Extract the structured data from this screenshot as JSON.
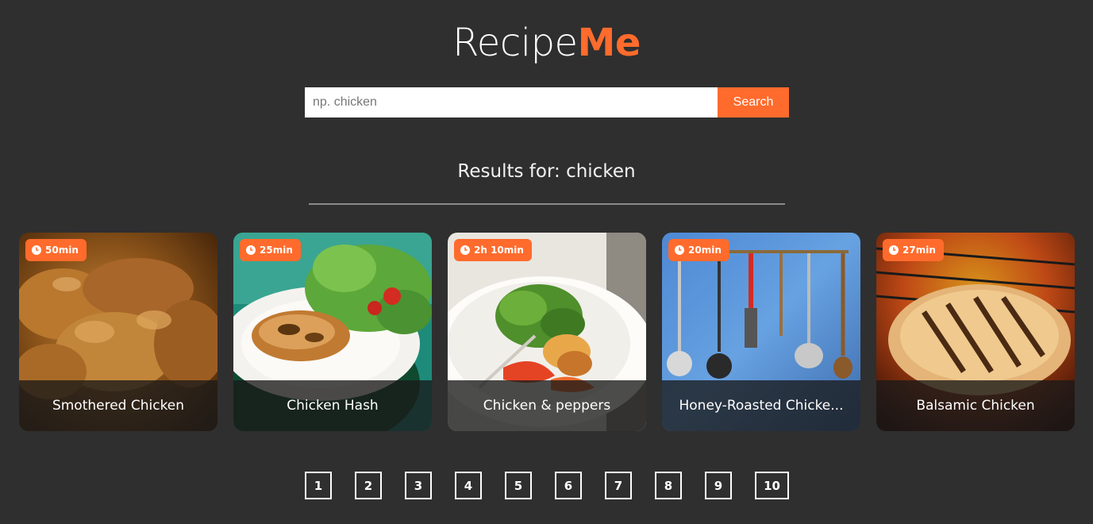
{
  "logo": {
    "part1": "Recipe",
    "part2": "Me"
  },
  "search": {
    "placeholder": "np. chicken",
    "value": "",
    "button_label": "Search"
  },
  "results": {
    "heading": "Results for: chicken"
  },
  "colors": {
    "accent": "#ff6b2c",
    "background": "#2f2f2f"
  },
  "cards": [
    {
      "time": "50min",
      "title": "Smothered Chicken"
    },
    {
      "time": "25min",
      "title": "Chicken Hash"
    },
    {
      "time": "2h 10min",
      "title": "Chicken & peppers"
    },
    {
      "time": "20min",
      "title": "Honey-Roasted Chicke..."
    },
    {
      "time": "27min",
      "title": "Balsamic Chicken"
    }
  ],
  "pagination": [
    "1",
    "2",
    "3",
    "4",
    "5",
    "6",
    "7",
    "8",
    "9",
    "10"
  ]
}
